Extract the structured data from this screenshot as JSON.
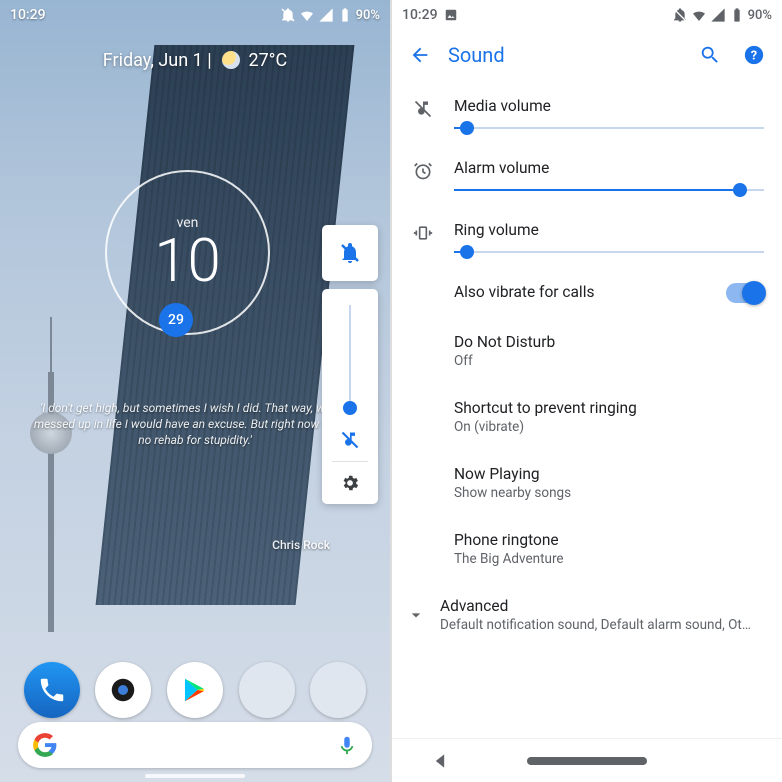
{
  "status": {
    "time": "10:29",
    "battery": "90%"
  },
  "home": {
    "date_line": "Friday, Jun 1 | ",
    "temp": "27°C",
    "widget_day": "ven",
    "widget_date": "10",
    "widget_badge": "29",
    "quote_text": "'I don't get high, but sometimes I wish I did. That way, when I messed up in life I would have an excuse. But right now there's no rehab for stupidity.'",
    "quote_author": "Chris Rock"
  },
  "volume_panel": {
    "slider_pos": 0
  },
  "settings": {
    "title": "Sound",
    "sliders": {
      "media": {
        "label": "Media volume",
        "value": 2
      },
      "alarm": {
        "label": "Alarm volume",
        "value": 90
      },
      "ring": {
        "label": "Ring volume",
        "value": 2
      }
    },
    "vibrate_label": "Also vibrate for calls",
    "vibrate_on": true,
    "items": [
      {
        "label": "Do Not Disturb",
        "sub": "Off"
      },
      {
        "label": "Shortcut to prevent ringing",
        "sub": "On (vibrate)"
      },
      {
        "label": "Now Playing",
        "sub": "Show nearby songs"
      },
      {
        "label": "Phone ringtone",
        "sub": "The Big Adventure"
      }
    ],
    "advanced": {
      "label": "Advanced",
      "sub": "Default notification sound, Default alarm sound, Ot…"
    }
  }
}
